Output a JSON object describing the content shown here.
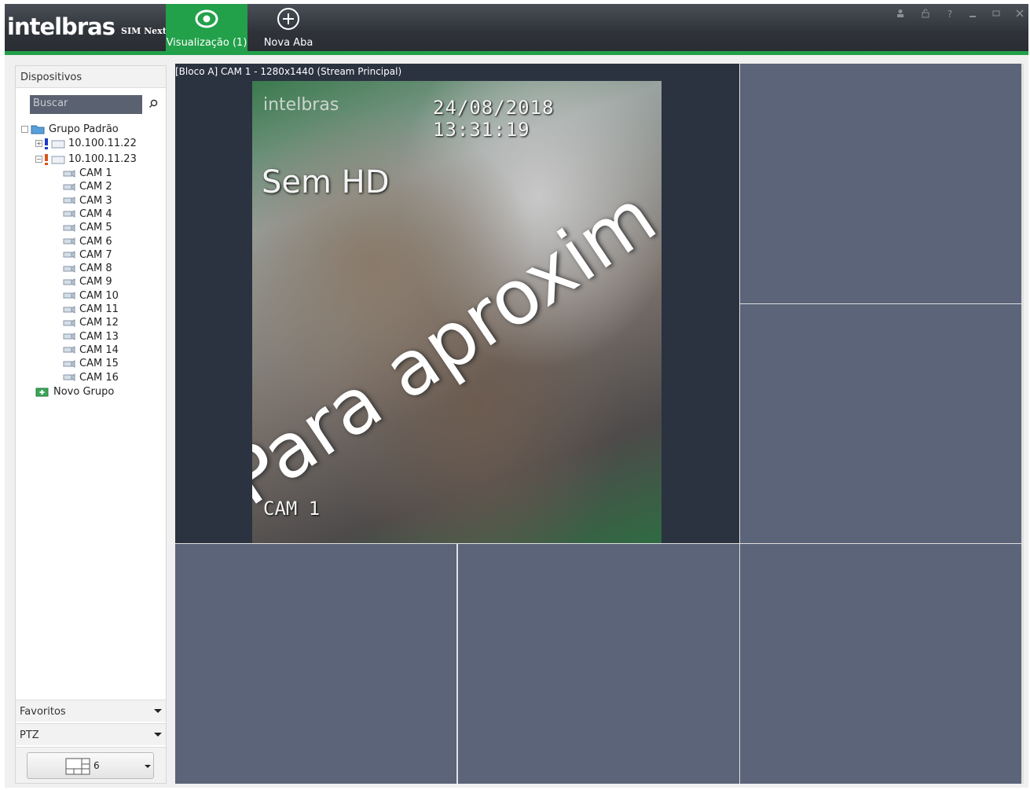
{
  "app": {
    "logo": "intelbras",
    "logo_sub": "SIM Next"
  },
  "tabs": [
    {
      "label": "Visualização (1)",
      "icon": "eye-icon",
      "active": true
    },
    {
      "label": "Nova Aba",
      "icon": "plus-circle-icon",
      "active": false
    }
  ],
  "window_controls": [
    "user-icon",
    "lock-icon",
    "help-icon",
    "minimize-icon",
    "maximize-icon",
    "close-icon"
  ],
  "sidebar": {
    "header": "Dispositivos",
    "search_placeholder": "Buscar",
    "tree": {
      "group": "Grupo Padrão",
      "devices": [
        {
          "ip": "10.100.11.22",
          "expanded": false
        },
        {
          "ip": "10.100.11.23",
          "expanded": true
        }
      ],
      "cameras": [
        "CAM 1",
        "CAM 2",
        "CAM 3",
        "CAM 4",
        "CAM 5",
        "CAM 6",
        "CAM 7",
        "CAM 8",
        "CAM 9",
        "CAM 10",
        "CAM 11",
        "CAM 12",
        "CAM 13",
        "CAM 14",
        "CAM 15",
        "CAM 16"
      ],
      "new_group": "Novo Grupo"
    },
    "favorites": "Favoritos",
    "ptz": "PTZ",
    "layout_value": "6"
  },
  "video": {
    "pane_title": "[Bloco A] CAM 1 - 1280x1440 (Stream Principal)",
    "overlay_logo": "intelbras",
    "timestamp": "24/08/2018 13:31:19",
    "no_hd": "Sem HD",
    "overlay_text": "Para aproxim",
    "camera_label": "CAM 1"
  },
  "colors": {
    "accent_green": "#22a04a",
    "titlebar": "#2f3339",
    "empty_pane": "#5b6478"
  }
}
